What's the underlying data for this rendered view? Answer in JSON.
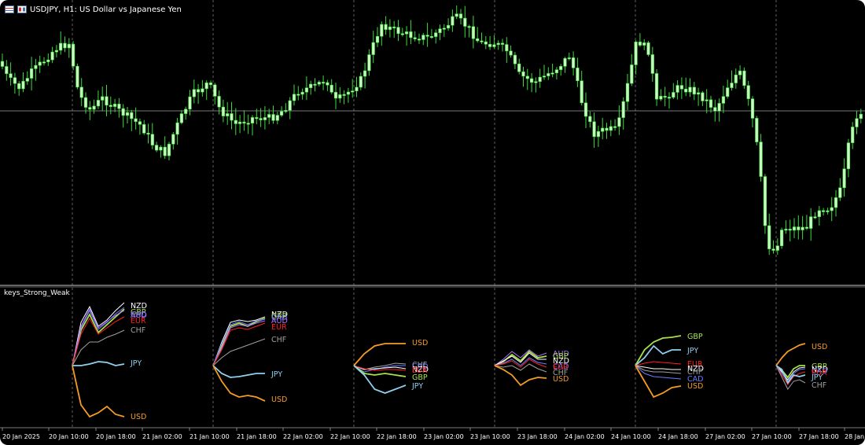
{
  "window": {
    "title": "USDJPY, H1:  US Dollar vs Japanese Yen",
    "icon_1": "chart-grid-icon",
    "icon_2": "window-toggle-icon"
  },
  "indicator": {
    "name": "keys_Strong_Weak"
  },
  "colors": {
    "background": "#000000",
    "bull_candle": "#c8ffc0",
    "wick": "#3adb3a",
    "grid": "#8a8a8a",
    "text": "#ffffff",
    "USD": "#f59b26",
    "JPY": "#8fd0f0",
    "GBP": "#a8e04a",
    "EUR": "#ff2020",
    "CHF": "#a0a0a0",
    "CAD": "#6a7cff",
    "AUD": "#b070ff",
    "NZD": "#ffffff"
  },
  "x_axis_labels": [
    "20 Jan 2025",
    "20 Jan 10:00",
    "20 Jan 18:00",
    "21 Jan 02:00",
    "21 Jan 10:00",
    "21 Jan 18:00",
    "22 Jan 02:00",
    "22 Jan 10:00",
    "22 Jan 18:00",
    "23 Jan 02:00",
    "23 Jan 10:00",
    "23 Jan 18:00",
    "24 Jan 02:00",
    "24 Jan 10:00",
    "24 Jan 18:00",
    "27 Jan 02:00",
    "27 Jan 10:00",
    "27 Jan 18:00",
    "28 Jan"
  ],
  "chart_data": {
    "type": "line",
    "title": "USDJPY, H1:  US Dollar vs Japanese Yen",
    "xlabel": "",
    "ylabel": "",
    "grid": true,
    "series_labels_per_block": [
      [
        "NZD",
        "GBP",
        "CAD",
        "AUD",
        "EUR",
        "CHF",
        "JPY",
        "USD"
      ],
      [
        "NZD",
        "GBP",
        "CAD",
        "AUD",
        "EUR",
        "CHF",
        "JPY",
        "USD"
      ],
      [
        "USD",
        "CHF",
        "CAD",
        "NZD",
        "EUR",
        "GBP",
        "JPY"
      ],
      [
        "AUD",
        "GBP",
        "NZD",
        "CAD",
        "EUR",
        "CHF",
        "USD"
      ],
      [
        "GBP",
        "JPY",
        "EUR",
        "NZD",
        "CHF",
        "CAD",
        "USD"
      ],
      [
        "USD",
        "GBP",
        "NZD",
        "CAD",
        "EUR",
        "JPY",
        "CHF"
      ]
    ]
  }
}
